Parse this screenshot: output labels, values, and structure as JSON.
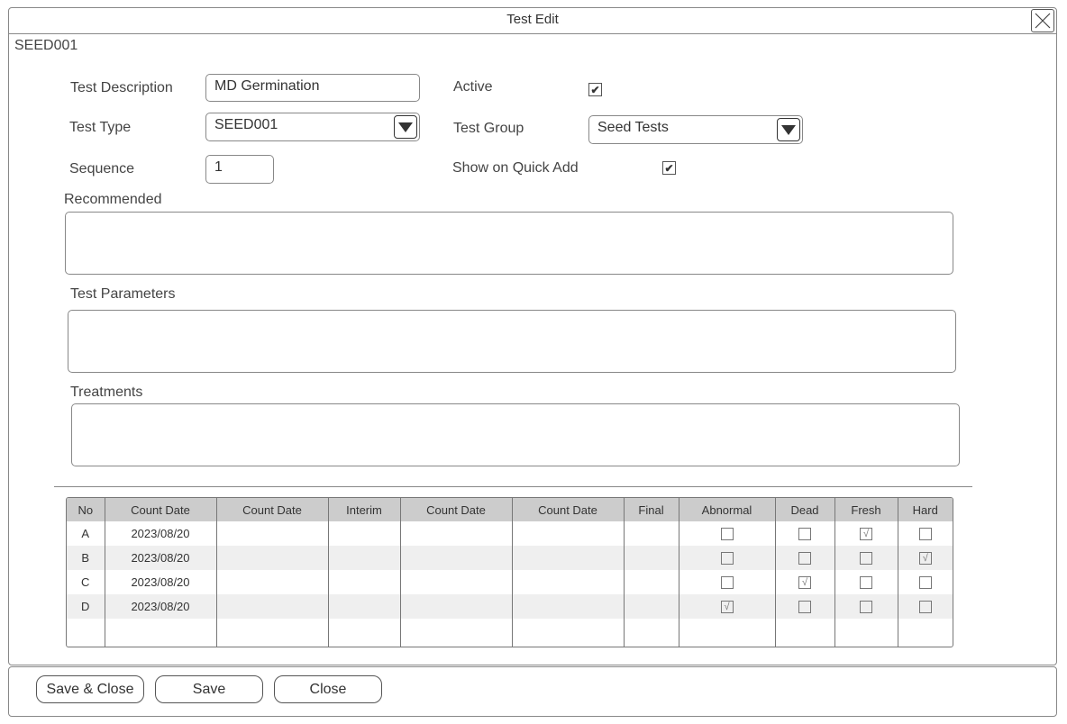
{
  "window": {
    "title": "Test Edit",
    "code": "SEED001"
  },
  "form": {
    "test_description_label": "Test Description",
    "test_description_value": "MD Germination",
    "active_label": "Active",
    "active_checked": true,
    "test_type_label": "Test Type",
    "test_type_value": "SEED001",
    "test_group_label": "Test Group",
    "test_group_value": "Seed Tests",
    "sequence_label": "Sequence",
    "sequence_value": "1",
    "quick_add_label": "Show on Quick Add",
    "quick_add_checked": true,
    "recommended_label": "Recommended",
    "test_parameters_label": "Test Parameters",
    "treatments_label": "Treatments"
  },
  "table": {
    "columns": [
      "No",
      "Count Date",
      "Count Date",
      "Interim",
      "Count Date",
      "Count Date",
      "Final",
      "Abnormal",
      "Dead",
      "Fresh",
      "Hard"
    ],
    "rows": [
      {
        "no": "A",
        "count_date": "2023/08/20",
        "checks": [
          false,
          false,
          true,
          false
        ]
      },
      {
        "no": "B",
        "count_date": "2023/08/20",
        "checks": [
          false,
          false,
          false,
          true
        ]
      },
      {
        "no": "C",
        "count_date": "2023/08/20",
        "checks": [
          false,
          true,
          false,
          false
        ]
      },
      {
        "no": "D",
        "count_date": "2023/08/20",
        "checks": [
          true,
          false,
          false,
          false
        ]
      }
    ]
  },
  "footer": {
    "save_close": "Save & Close",
    "save": "Save",
    "close": "Close"
  }
}
